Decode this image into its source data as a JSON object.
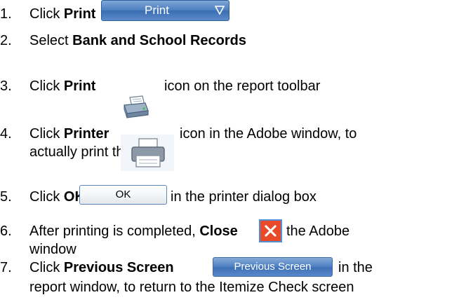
{
  "steps": [
    {
      "number": "1.",
      "before": "Click ",
      "bold": "Print",
      "after": ""
    },
    {
      "number": "2.",
      "before": "Select ",
      "bold": "Bank and School Records",
      "after": ""
    },
    {
      "number": "3.",
      "before": "Click ",
      "bold": "Print",
      "after": "icon on the report toolbar"
    },
    {
      "number": "4.",
      "before": "Click ",
      "bold": "Printer",
      "after": "icon in the Adobe window, to",
      "line2": "actually print the report"
    },
    {
      "number": "5.",
      "before": "Click ",
      "bold": "OK",
      "after": "in the printer dialog box"
    },
    {
      "number": "6.",
      "before": "After printing is completed, ",
      "bold": "Close",
      "after": "the Adobe",
      "line2": "window"
    },
    {
      "number": "7.",
      "before": "Click ",
      "bold": "Previous Screen",
      "after": "in the",
      "line2": "report window, to return to the Itemize Check screen"
    }
  ],
  "buttons": {
    "print_label": "Print",
    "ok_label": "OK",
    "previous_screen_label": "Previous Screen"
  },
  "icons": {
    "print_caret": "chevron-down-icon",
    "toolbar_print": "printer-icon",
    "adobe_printer": "printer-icon",
    "close": "close-icon"
  },
  "colors": {
    "button_blue": "#4e7fc0",
    "close_red": "#e94b2a",
    "close_border": "#4e8fd6"
  }
}
